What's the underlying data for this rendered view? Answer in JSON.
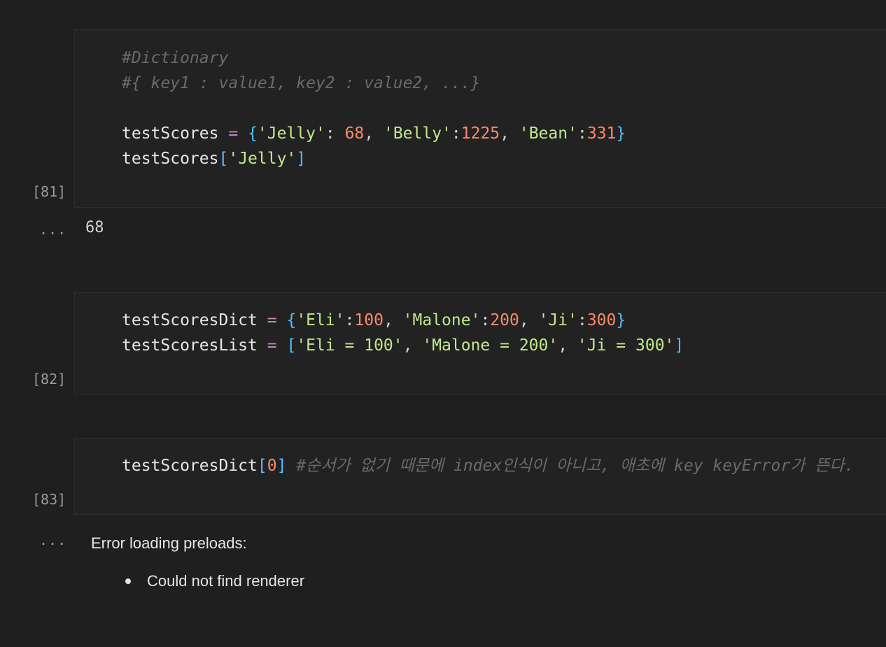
{
  "cells": [
    {
      "exec_count": "[81]",
      "lines": [
        [
          {
            "t": "#Dictionary",
            "c": "cm"
          }
        ],
        [
          {
            "t": "#{ key1 : value1, key2 : value2, ...}",
            "c": "cm"
          }
        ],
        [],
        [
          {
            "t": "testScores",
            "c": "var"
          },
          {
            "t": " ",
            "c": "pl"
          },
          {
            "t": "=",
            "c": "op"
          },
          {
            "t": " ",
            "c": "pl"
          },
          {
            "t": "{",
            "c": "br1"
          },
          {
            "t": "'Jelly'",
            "c": "str"
          },
          {
            "t": ": ",
            "c": "pl"
          },
          {
            "t": "68",
            "c": "num"
          },
          {
            "t": ", ",
            "c": "pl"
          },
          {
            "t": "'Belly'",
            "c": "str"
          },
          {
            "t": ":",
            "c": "pl"
          },
          {
            "t": "1225",
            "c": "num"
          },
          {
            "t": ", ",
            "c": "pl"
          },
          {
            "t": "'Bean'",
            "c": "str"
          },
          {
            "t": ":",
            "c": "pl"
          },
          {
            "t": "331",
            "c": "num"
          },
          {
            "t": "}",
            "c": "br1"
          }
        ],
        [
          {
            "t": "testScores",
            "c": "var"
          },
          {
            "t": "[",
            "c": "br1"
          },
          {
            "t": "'Jelly'",
            "c": "str"
          },
          {
            "t": "]",
            "c": "br1"
          }
        ]
      ],
      "output_marker": "...",
      "output": "68"
    },
    {
      "exec_count": "[82]",
      "lines": [
        [
          {
            "t": "testScoresDict",
            "c": "var"
          },
          {
            "t": " ",
            "c": "pl"
          },
          {
            "t": "=",
            "c": "op"
          },
          {
            "t": " ",
            "c": "pl"
          },
          {
            "t": "{",
            "c": "br1"
          },
          {
            "t": "'Eli'",
            "c": "str"
          },
          {
            "t": ":",
            "c": "pl"
          },
          {
            "t": "100",
            "c": "num"
          },
          {
            "t": ", ",
            "c": "pl"
          },
          {
            "t": "'Malone'",
            "c": "str"
          },
          {
            "t": ":",
            "c": "pl"
          },
          {
            "t": "200",
            "c": "num"
          },
          {
            "t": ", ",
            "c": "pl"
          },
          {
            "t": "'Ji'",
            "c": "str"
          },
          {
            "t": ":",
            "c": "pl"
          },
          {
            "t": "300",
            "c": "num"
          },
          {
            "t": "}",
            "c": "br1"
          }
        ],
        [
          {
            "t": "testScoresList",
            "c": "var"
          },
          {
            "t": " ",
            "c": "pl"
          },
          {
            "t": "=",
            "c": "op"
          },
          {
            "t": " ",
            "c": "pl"
          },
          {
            "t": "[",
            "c": "br1"
          },
          {
            "t": "'Eli = 100'",
            "c": "str"
          },
          {
            "t": ", ",
            "c": "pl"
          },
          {
            "t": "'Malone = 200'",
            "c": "str"
          },
          {
            "t": ", ",
            "c": "pl"
          },
          {
            "t": "'Ji = 300'",
            "c": "str"
          },
          {
            "t": "]",
            "c": "br1"
          }
        ]
      ]
    },
    {
      "exec_count": "[83]",
      "lines": [
        [
          {
            "t": "testScoresDict",
            "c": "var"
          },
          {
            "t": "[",
            "c": "br1"
          },
          {
            "t": "0",
            "c": "num"
          },
          {
            "t": "]",
            "c": "br1"
          },
          {
            "t": " ",
            "c": "pl"
          },
          {
            "t": "#순서가 없기 때문에 index인식이 아니고, 애초에 key keyError가 뜬다.",
            "c": "cm"
          }
        ]
      ],
      "output_marker": "...",
      "error_title": "Error loading preloads:",
      "error_items": [
        "Could not find renderer"
      ]
    }
  ],
  "colors": {
    "background": "#1f1f1f",
    "cell_background": "#222222",
    "comment": "#6a6a6a",
    "keyword_operator": "#c586c0",
    "bracket": "#4fc1ff",
    "string": "#c3e88d",
    "number": "#f78c6c"
  }
}
